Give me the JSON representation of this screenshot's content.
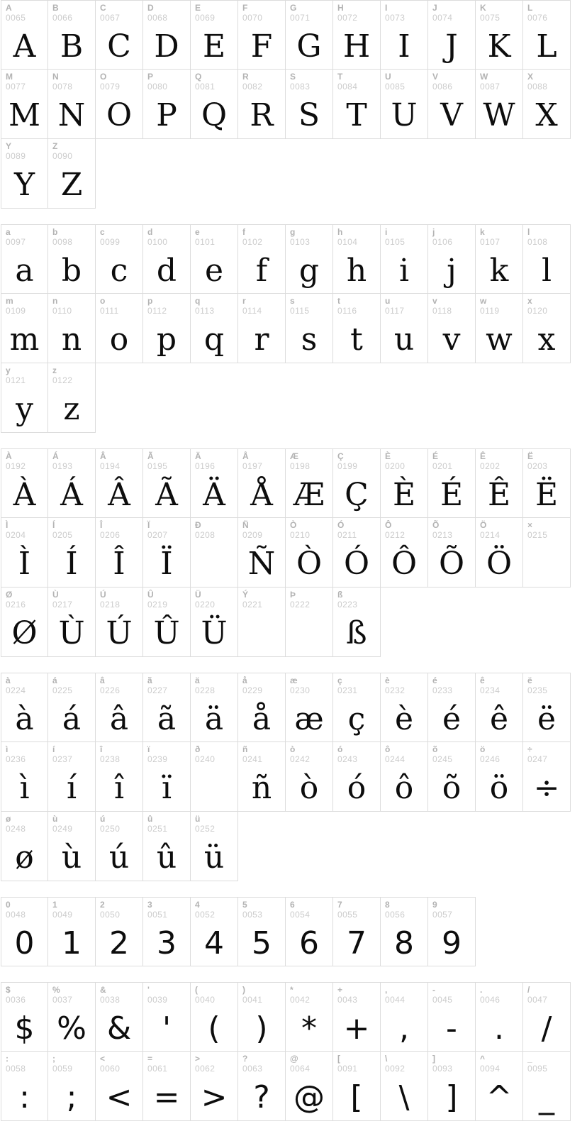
{
  "page": {
    "title": "Font Character Map",
    "type": "character-map"
  },
  "sections": [
    {
      "name": "uppercase-latin",
      "columns": 12,
      "style": "serif",
      "cells": [
        {
          "label": "A",
          "code": "0065",
          "glyph": "A"
        },
        {
          "label": "B",
          "code": "0066",
          "glyph": "B"
        },
        {
          "label": "C",
          "code": "0067",
          "glyph": "C"
        },
        {
          "label": "D",
          "code": "0068",
          "glyph": "D"
        },
        {
          "label": "E",
          "code": "0069",
          "glyph": "E"
        },
        {
          "label": "F",
          "code": "0070",
          "glyph": "F"
        },
        {
          "label": "G",
          "code": "0071",
          "glyph": "G"
        },
        {
          "label": "H",
          "code": "0072",
          "glyph": "H"
        },
        {
          "label": "I",
          "code": "0073",
          "glyph": "I"
        },
        {
          "label": "J",
          "code": "0074",
          "glyph": "J"
        },
        {
          "label": "K",
          "code": "0075",
          "glyph": "K"
        },
        {
          "label": "L",
          "code": "0076",
          "glyph": "L"
        },
        {
          "label": "M",
          "code": "0077",
          "glyph": "M"
        },
        {
          "label": "N",
          "code": "0078",
          "glyph": "N"
        },
        {
          "label": "O",
          "code": "0079",
          "glyph": "O"
        },
        {
          "label": "P",
          "code": "0080",
          "glyph": "P"
        },
        {
          "label": "Q",
          "code": "0081",
          "glyph": "Q"
        },
        {
          "label": "R",
          "code": "0082",
          "glyph": "R"
        },
        {
          "label": "S",
          "code": "0083",
          "glyph": "S"
        },
        {
          "label": "T",
          "code": "0084",
          "glyph": "T"
        },
        {
          "label": "U",
          "code": "0085",
          "glyph": "U"
        },
        {
          "label": "V",
          "code": "0086",
          "glyph": "V"
        },
        {
          "label": "W",
          "code": "0087",
          "glyph": "W"
        },
        {
          "label": "X",
          "code": "0088",
          "glyph": "X"
        },
        {
          "label": "Y",
          "code": "0089",
          "glyph": "Y"
        },
        {
          "label": "Z",
          "code": "0090",
          "glyph": "Z"
        }
      ]
    },
    {
      "name": "lowercase-latin",
      "columns": 12,
      "style": "serif",
      "cells": [
        {
          "label": "a",
          "code": "0097",
          "glyph": "a"
        },
        {
          "label": "b",
          "code": "0098",
          "glyph": "b"
        },
        {
          "label": "c",
          "code": "0099",
          "glyph": "c"
        },
        {
          "label": "d",
          "code": "0100",
          "glyph": "d"
        },
        {
          "label": "e",
          "code": "0101",
          "glyph": "e"
        },
        {
          "label": "f",
          "code": "0102",
          "glyph": "f"
        },
        {
          "label": "g",
          "code": "0103",
          "glyph": "g"
        },
        {
          "label": "h",
          "code": "0104",
          "glyph": "h"
        },
        {
          "label": "i",
          "code": "0105",
          "glyph": "i"
        },
        {
          "label": "j",
          "code": "0106",
          "glyph": "j"
        },
        {
          "label": "k",
          "code": "0107",
          "glyph": "k"
        },
        {
          "label": "l",
          "code": "0108",
          "glyph": "l"
        },
        {
          "label": "m",
          "code": "0109",
          "glyph": "m"
        },
        {
          "label": "n",
          "code": "0110",
          "glyph": "n"
        },
        {
          "label": "o",
          "code": "0111",
          "glyph": "o"
        },
        {
          "label": "p",
          "code": "0112",
          "glyph": "p"
        },
        {
          "label": "q",
          "code": "0113",
          "glyph": "q"
        },
        {
          "label": "r",
          "code": "0114",
          "glyph": "r"
        },
        {
          "label": "s",
          "code": "0115",
          "glyph": "s"
        },
        {
          "label": "t",
          "code": "0116",
          "glyph": "t"
        },
        {
          "label": "u",
          "code": "0117",
          "glyph": "u"
        },
        {
          "label": "v",
          "code": "0118",
          "glyph": "v"
        },
        {
          "label": "w",
          "code": "0119",
          "glyph": "w"
        },
        {
          "label": "x",
          "code": "0120",
          "glyph": "x"
        },
        {
          "label": "y",
          "code": "0121",
          "glyph": "y"
        },
        {
          "label": "z",
          "code": "0122",
          "glyph": "z"
        }
      ]
    },
    {
      "name": "uppercase-accented",
      "columns": 12,
      "style": "serif",
      "cells": [
        {
          "label": "À",
          "code": "0192",
          "glyph": "À"
        },
        {
          "label": "Á",
          "code": "0193",
          "glyph": "Á"
        },
        {
          "label": "Â",
          "code": "0194",
          "glyph": "Â"
        },
        {
          "label": "Ã",
          "code": "0195",
          "glyph": "Ã"
        },
        {
          "label": "Ä",
          "code": "0196",
          "glyph": "Ä"
        },
        {
          "label": "Å",
          "code": "0197",
          "glyph": "Å"
        },
        {
          "label": "Æ",
          "code": "0198",
          "glyph": "Æ"
        },
        {
          "label": "Ç",
          "code": "0199",
          "glyph": "Ç"
        },
        {
          "label": "È",
          "code": "0200",
          "glyph": "È"
        },
        {
          "label": "É",
          "code": "0201",
          "glyph": "É"
        },
        {
          "label": "Ê",
          "code": "0202",
          "glyph": "Ê"
        },
        {
          "label": "Ë",
          "code": "0203",
          "glyph": "Ë"
        },
        {
          "label": "Ì",
          "code": "0204",
          "glyph": "Ì"
        },
        {
          "label": "Í",
          "code": "0205",
          "glyph": "Í"
        },
        {
          "label": "Î",
          "code": "0206",
          "glyph": "Î"
        },
        {
          "label": "Ï",
          "code": "0207",
          "glyph": "Ï"
        },
        {
          "label": "Ð",
          "code": "0208",
          "glyph": "",
          "empty": true
        },
        {
          "label": "Ñ",
          "code": "0209",
          "glyph": "Ñ"
        },
        {
          "label": "Ò",
          "code": "0210",
          "glyph": "Ò"
        },
        {
          "label": "Ó",
          "code": "0211",
          "glyph": "Ó"
        },
        {
          "label": "Ô",
          "code": "0212",
          "glyph": "Ô"
        },
        {
          "label": "Õ",
          "code": "0213",
          "glyph": "Õ"
        },
        {
          "label": "Ö",
          "code": "0214",
          "glyph": "Ö"
        },
        {
          "label": "×",
          "code": "0215",
          "glyph": "",
          "empty": true
        },
        {
          "label": "Ø",
          "code": "0216",
          "glyph": "Ø"
        },
        {
          "label": "Ù",
          "code": "0217",
          "glyph": "Ù"
        },
        {
          "label": "Ú",
          "code": "0218",
          "glyph": "Ú"
        },
        {
          "label": "Û",
          "code": "0219",
          "glyph": "Û"
        },
        {
          "label": "Ü",
          "code": "0220",
          "glyph": "Ü"
        },
        {
          "label": "Ý",
          "code": "0221",
          "glyph": "",
          "empty": true
        },
        {
          "label": "Þ",
          "code": "0222",
          "glyph": "",
          "empty": true
        },
        {
          "label": "ß",
          "code": "0223",
          "glyph": "ß"
        }
      ]
    },
    {
      "name": "lowercase-accented",
      "columns": 12,
      "style": "serif",
      "cells": [
        {
          "label": "à",
          "code": "0224",
          "glyph": "à"
        },
        {
          "label": "á",
          "code": "0225",
          "glyph": "á"
        },
        {
          "label": "â",
          "code": "0226",
          "glyph": "â"
        },
        {
          "label": "ã",
          "code": "0227",
          "glyph": "ã"
        },
        {
          "label": "ä",
          "code": "0228",
          "glyph": "ä"
        },
        {
          "label": "å",
          "code": "0229",
          "glyph": "å"
        },
        {
          "label": "æ",
          "code": "0230",
          "glyph": "æ"
        },
        {
          "label": "ç",
          "code": "0231",
          "glyph": "ç"
        },
        {
          "label": "è",
          "code": "0232",
          "glyph": "è"
        },
        {
          "label": "é",
          "code": "0233",
          "glyph": "é"
        },
        {
          "label": "ê",
          "code": "0234",
          "glyph": "ê"
        },
        {
          "label": "ë",
          "code": "0235",
          "glyph": "ë"
        },
        {
          "label": "ì",
          "code": "0236",
          "glyph": "ì"
        },
        {
          "label": "í",
          "code": "0237",
          "glyph": "í"
        },
        {
          "label": "î",
          "code": "0238",
          "glyph": "î"
        },
        {
          "label": "ï",
          "code": "0239",
          "glyph": "ï"
        },
        {
          "label": "ð",
          "code": "0240",
          "glyph": "",
          "empty": true
        },
        {
          "label": "ñ",
          "code": "0241",
          "glyph": "ñ"
        },
        {
          "label": "ò",
          "code": "0242",
          "glyph": "ò"
        },
        {
          "label": "ó",
          "code": "0243",
          "glyph": "ó"
        },
        {
          "label": "ô",
          "code": "0244",
          "glyph": "ô"
        },
        {
          "label": "õ",
          "code": "0245",
          "glyph": "õ"
        },
        {
          "label": "ö",
          "code": "0246",
          "glyph": "ö"
        },
        {
          "label": "÷",
          "code": "0247",
          "glyph": "÷"
        },
        {
          "label": "ø",
          "code": "0248",
          "glyph": "ø"
        },
        {
          "label": "ù",
          "code": "0249",
          "glyph": "ù"
        },
        {
          "label": "ú",
          "code": "0250",
          "glyph": "ú"
        },
        {
          "label": "û",
          "code": "0251",
          "glyph": "û"
        },
        {
          "label": "ü",
          "code": "0252",
          "glyph": "ü"
        }
      ]
    },
    {
      "name": "digits",
      "columns": 10,
      "style": "sans",
      "cells": [
        {
          "label": "0",
          "code": "0048",
          "glyph": "0"
        },
        {
          "label": "1",
          "code": "0049",
          "glyph": "1"
        },
        {
          "label": "2",
          "code": "0050",
          "glyph": "2"
        },
        {
          "label": "3",
          "code": "0051",
          "glyph": "3"
        },
        {
          "label": "4",
          "code": "0052",
          "glyph": "4"
        },
        {
          "label": "5",
          "code": "0053",
          "glyph": "5"
        },
        {
          "label": "6",
          "code": "0054",
          "glyph": "6"
        },
        {
          "label": "7",
          "code": "0055",
          "glyph": "7"
        },
        {
          "label": "8",
          "code": "0056",
          "glyph": "8"
        },
        {
          "label": "9",
          "code": "0057",
          "glyph": "9"
        }
      ]
    },
    {
      "name": "punctuation-symbols",
      "columns": 12,
      "style": "sans",
      "cells": [
        {
          "label": "$",
          "code": "0036",
          "glyph": "$"
        },
        {
          "label": "%",
          "code": "0037",
          "glyph": "%"
        },
        {
          "label": "&",
          "code": "0038",
          "glyph": "&"
        },
        {
          "label": "'",
          "code": "0039",
          "glyph": "'"
        },
        {
          "label": "(",
          "code": "0040",
          "glyph": "("
        },
        {
          "label": ")",
          "code": "0041",
          "glyph": ")"
        },
        {
          "label": "*",
          "code": "0042",
          "glyph": "*"
        },
        {
          "label": "+",
          "code": "0043",
          "glyph": "+"
        },
        {
          "label": ",",
          "code": "0044",
          "glyph": ","
        },
        {
          "label": "-",
          "code": "0045",
          "glyph": "-"
        },
        {
          "label": ".",
          "code": "0046",
          "glyph": "."
        },
        {
          "label": "/",
          "code": "0047",
          "glyph": "/"
        },
        {
          "label": ":",
          "code": "0058",
          "glyph": ":"
        },
        {
          "label": ";",
          "code": "0059",
          "glyph": ";"
        },
        {
          "label": "<",
          "code": "0060",
          "glyph": "<"
        },
        {
          "label": "=",
          "code": "0061",
          "glyph": "="
        },
        {
          "label": ">",
          "code": "0062",
          "glyph": ">"
        },
        {
          "label": "?",
          "code": "0063",
          "glyph": "?"
        },
        {
          "label": "@",
          "code": "0064",
          "glyph": "@"
        },
        {
          "label": "[",
          "code": "0091",
          "glyph": "["
        },
        {
          "label": "\\",
          "code": "0092",
          "glyph": "\\"
        },
        {
          "label": "]",
          "code": "0093",
          "glyph": "]"
        },
        {
          "label": "^",
          "code": "0094",
          "glyph": "^"
        },
        {
          "label": "_",
          "code": "0095",
          "glyph": "_"
        }
      ]
    }
  ],
  "colors": {
    "grid_border": "#dcdcdc",
    "label_text": "#b3b3b3",
    "code_text": "#cccccc",
    "glyph_text": "#0d0d0d",
    "background": "#ffffff"
  }
}
